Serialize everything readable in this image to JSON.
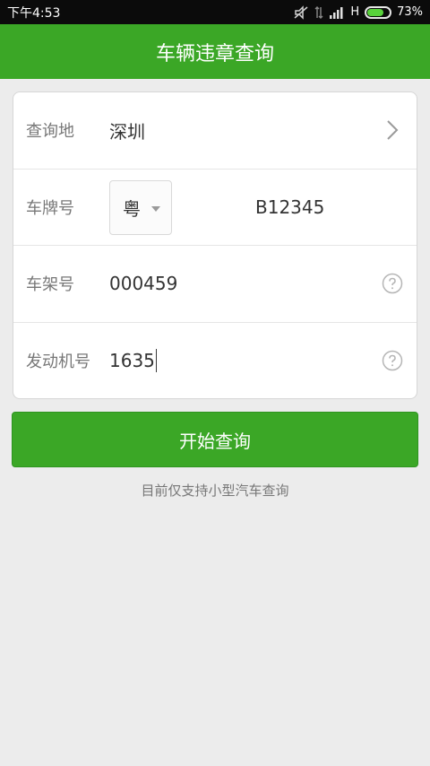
{
  "status_bar": {
    "time": "下午4:53",
    "network": "H",
    "battery": "73%",
    "battery_level": 0.73
  },
  "header": {
    "title": "车辆违章查询"
  },
  "form": {
    "location": {
      "label": "查询地",
      "value": "深圳"
    },
    "plate": {
      "label": "车牌号",
      "province": "粤",
      "number": "B12345"
    },
    "frame": {
      "label": "车架号",
      "value": "000459"
    },
    "engine": {
      "label": "发动机号",
      "value": "1635"
    }
  },
  "actions": {
    "query_label": "开始查询"
  },
  "note": "目前仅支持小型汽车查询",
  "colors": {
    "accent": "#3ba726",
    "status_bar": "#0b0b0b",
    "background": "#ececec"
  }
}
